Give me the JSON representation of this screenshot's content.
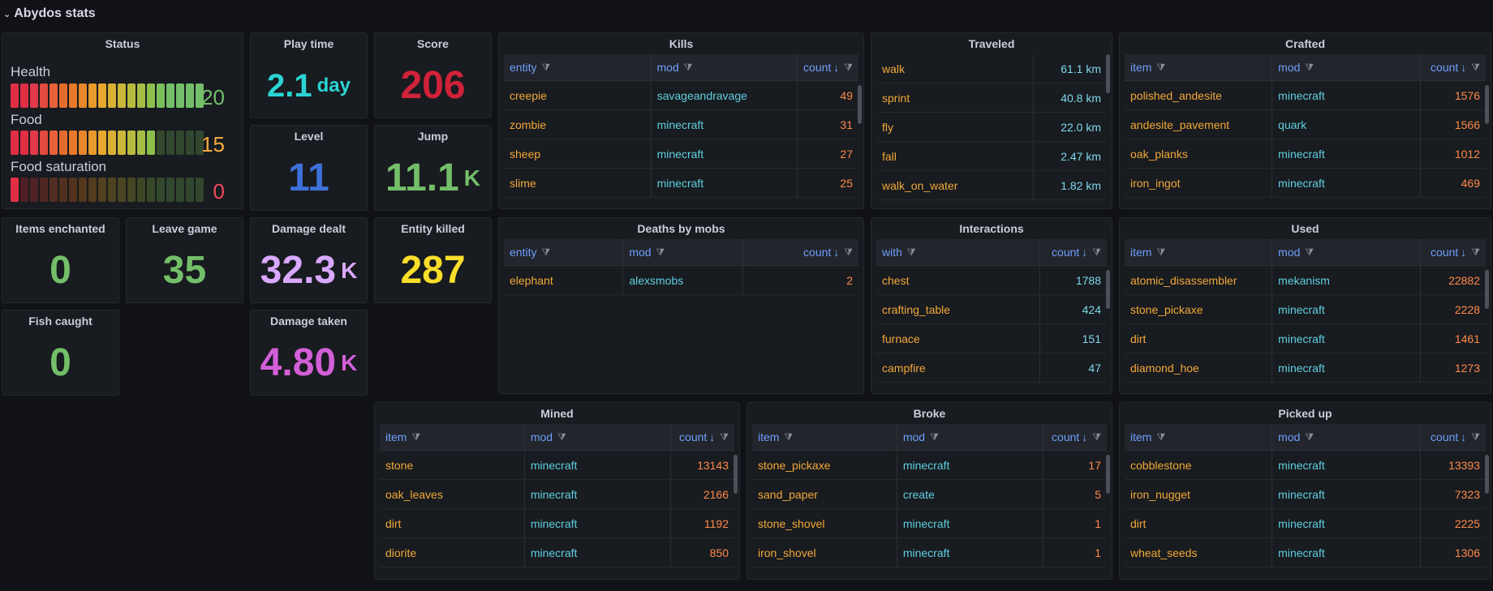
{
  "row_title": "Abydos stats",
  "colors": {
    "background": "#111217",
    "panel": "#181b1f",
    "header_blue": "#6e9fff",
    "key_orange": "#f2a83a",
    "mod_cyan": "#5fcfe0",
    "count_orange": "#ff8a4a"
  },
  "status": {
    "title": "Status",
    "health": {
      "label": "Health",
      "value": "20",
      "level": 20,
      "max": 20
    },
    "food": {
      "label": "Food",
      "value": "15",
      "level": 15,
      "max": 20
    },
    "saturation": {
      "label": "Food saturation",
      "value": "0",
      "level": 0,
      "max": 20
    }
  },
  "stats": {
    "play_time": {
      "title": "Play time",
      "value": "2.1",
      "unit": "day"
    },
    "score": {
      "title": "Score",
      "value": "206"
    },
    "level": {
      "title": "Level",
      "value": "11"
    },
    "jump": {
      "title": "Jump",
      "value": "11.1",
      "unit": "K"
    },
    "items_enchanted": {
      "title": "Items enchanted",
      "value": "0"
    },
    "leave_game": {
      "title": "Leave game",
      "value": "35"
    },
    "damage_dealt": {
      "title": "Damage dealt",
      "value": "32.3",
      "unit": "K"
    },
    "entity_killed": {
      "title": "Entity killed",
      "value": "287"
    },
    "fish_caught": {
      "title": "Fish caught",
      "value": "0"
    },
    "damage_taken": {
      "title": "Damage taken",
      "value": "4.80",
      "unit": "K"
    }
  },
  "kills": {
    "title": "Kills",
    "columns": [
      "entity",
      "mod",
      "count"
    ],
    "rows": [
      [
        "creepie",
        "savageandravage",
        "49"
      ],
      [
        "zombie",
        "minecraft",
        "31"
      ],
      [
        "sheep",
        "minecraft",
        "27"
      ],
      [
        "slime",
        "minecraft",
        "25"
      ]
    ]
  },
  "traveled": {
    "title": "Traveled",
    "rows": [
      [
        "walk",
        "61.1 km"
      ],
      [
        "sprint",
        "40.8 km"
      ],
      [
        "fly",
        "22.0 km"
      ],
      [
        "fall",
        "2.47 km"
      ],
      [
        "walk_on_water",
        "1.82 km"
      ]
    ]
  },
  "crafted": {
    "title": "Crafted",
    "columns": [
      "item",
      "mod",
      "count"
    ],
    "rows": [
      [
        "polished_andesite",
        "minecraft",
        "1576"
      ],
      [
        "andesite_pavement",
        "quark",
        "1566"
      ],
      [
        "oak_planks",
        "minecraft",
        "1012"
      ],
      [
        "iron_ingot",
        "minecraft",
        "469"
      ]
    ]
  },
  "deaths": {
    "title": "Deaths by mobs",
    "columns": [
      "entity",
      "mod",
      "count"
    ],
    "rows": [
      [
        "elephant",
        "alexsmobs",
        "2"
      ]
    ]
  },
  "interactions": {
    "title": "Interactions",
    "columns": [
      "with",
      "count"
    ],
    "rows": [
      [
        "chest",
        "1788"
      ],
      [
        "crafting_table",
        "424"
      ],
      [
        "furnace",
        "151"
      ],
      [
        "campfire",
        "47"
      ]
    ]
  },
  "used": {
    "title": "Used",
    "columns": [
      "item",
      "mod",
      "count"
    ],
    "rows": [
      [
        "atomic_disassembler",
        "mekanism",
        "22882"
      ],
      [
        "stone_pickaxe",
        "minecraft",
        "2228"
      ],
      [
        "dirt",
        "minecraft",
        "1461"
      ],
      [
        "diamond_hoe",
        "minecraft",
        "1273"
      ]
    ]
  },
  "mined": {
    "title": "Mined",
    "columns": [
      "item",
      "mod",
      "count"
    ],
    "rows": [
      [
        "stone",
        "minecraft",
        "13143"
      ],
      [
        "oak_leaves",
        "minecraft",
        "2166"
      ],
      [
        "dirt",
        "minecraft",
        "1192"
      ],
      [
        "diorite",
        "minecraft",
        "850"
      ]
    ]
  },
  "broke": {
    "title": "Broke",
    "columns": [
      "item",
      "mod",
      "count"
    ],
    "rows": [
      [
        "stone_pickaxe",
        "minecraft",
        "17"
      ],
      [
        "sand_paper",
        "create",
        "5"
      ],
      [
        "stone_shovel",
        "minecraft",
        "1"
      ],
      [
        "iron_shovel",
        "minecraft",
        "1"
      ]
    ]
  },
  "picked": {
    "title": "Picked up",
    "columns": [
      "item",
      "mod",
      "count"
    ],
    "rows": [
      [
        "cobblestone",
        "minecraft",
        "13393"
      ],
      [
        "iron_nugget",
        "minecraft",
        "7323"
      ],
      [
        "dirt",
        "minecraft",
        "2225"
      ],
      [
        "wheat_seeds",
        "minecraft",
        "1306"
      ]
    ]
  }
}
